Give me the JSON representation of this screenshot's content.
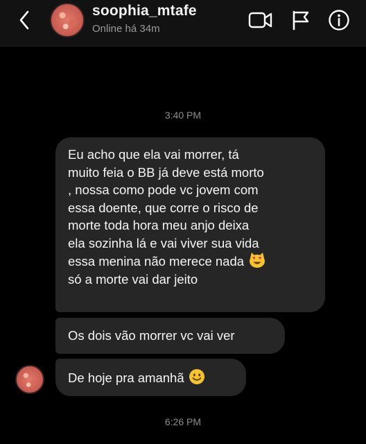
{
  "header": {
    "username": "soophia_mtafe",
    "status": "Online há 34m",
    "icons": [
      "chevron-left-icon",
      "video-camera-icon",
      "flag-icon",
      "info-icon"
    ]
  },
  "timestamps": [
    "3:40 PM",
    "6:26 PM"
  ],
  "messages": [
    {
      "lines": [
        "Eu acho que ela vai morrer, tá",
        "muito feia o BB já deve está morto",
        ", nossa como pode vc jovem com",
        "essa doente, que corre o risco de",
        "morte toda hora meu anjo deixa",
        "ela sozinha lá e vai viver sua vida",
        "essa menina não merece nada",
        "só a morte vai dar jeito"
      ],
      "emoji": "heart-eyes-cat-emoji"
    },
    {
      "text": "Os dois vão morrer vc vai ver"
    },
    {
      "text": "De hoje pra amanhã",
      "emoji": "smiling-face-emoji"
    }
  ],
  "colors": {
    "background": "#000000",
    "header": "#121212",
    "bubble": "#262626",
    "secondary_text": "#8e8e8e",
    "emoji_yellow": "#f4c232"
  }
}
